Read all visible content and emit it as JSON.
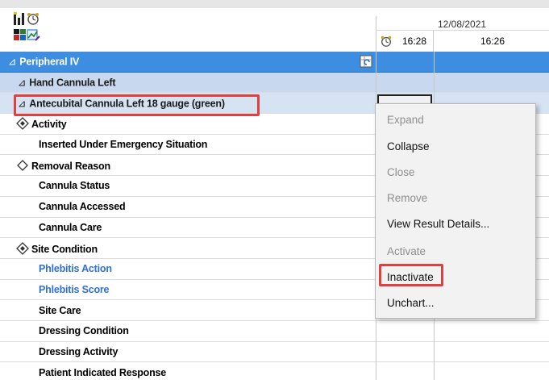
{
  "header": {
    "date": "12/08/2021",
    "col1_time": "16:28",
    "col2_time": "16:26"
  },
  "rows": [
    {
      "label": "Peripheral IV",
      "kind": "section"
    },
    {
      "label": "Hand Cannula Left",
      "kind": "sub"
    },
    {
      "label": "Antecubital Cannula Left 18 gauge (green)",
      "kind": "sub2"
    },
    {
      "label": "Activity",
      "kind": "diamond-filled"
    },
    {
      "label": "Inserted Under Emergency Situation",
      "kind": "item"
    },
    {
      "label": "Removal Reason",
      "kind": "diamond-outline"
    },
    {
      "label": "Cannula Status",
      "kind": "item"
    },
    {
      "label": "Cannula Accessed",
      "kind": "item"
    },
    {
      "label": "Cannula Care",
      "kind": "item"
    },
    {
      "label": "Site Condition",
      "kind": "diamond-filled"
    },
    {
      "label": "Phlebitis Action",
      "kind": "item-blue"
    },
    {
      "label": "Phlebitis Score",
      "kind": "item-blue"
    },
    {
      "label": "Site Care",
      "kind": "item"
    },
    {
      "label": "Dressing Condition",
      "kind": "item"
    },
    {
      "label": "Dressing Activity",
      "kind": "item"
    },
    {
      "label": "Patient Indicated Response",
      "kind": "item"
    }
  ],
  "context_menu": {
    "items": [
      {
        "label": "Expand",
        "enabled": false
      },
      {
        "label": "Collapse",
        "enabled": true
      },
      {
        "label": "Close",
        "enabled": false
      },
      {
        "label": "Remove",
        "enabled": false
      },
      {
        "label": "View Result Details...",
        "enabled": true
      },
      {
        "label": "Activate",
        "enabled": false
      },
      {
        "label": "Inactivate",
        "enabled": true
      },
      {
        "label": "Unchart...",
        "enabled": true
      }
    ]
  },
  "icons": {
    "toolbar": [
      "bar-chart-icon",
      "alarm-clock-icon",
      "flowsheet-icon",
      "chart-edit-icon"
    ],
    "section": "grid-refresh-icon",
    "header_col1": "alarm-clock-icon"
  },
  "colors": {
    "section_bg": "#3d8de0",
    "sub_bg": "#c8d8ef",
    "highlight": "#e0403f",
    "link_blue": "#2f6fd6",
    "menu_bg": "#f2f2f2"
  }
}
